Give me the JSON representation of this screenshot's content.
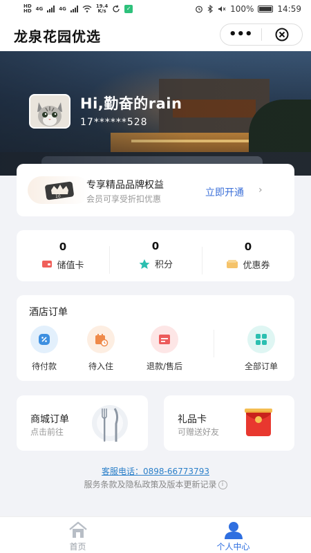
{
  "statusbar": {
    "net_left_1": "HD",
    "net_left_2": "HD",
    "network1": "4G",
    "network2": "4G",
    "speed_value": "19.4",
    "speed_unit": "K/s",
    "battery": "100%",
    "time": "14:59"
  },
  "header": {
    "title": "龙泉花园优选",
    "more_icon": "more-dots-icon",
    "close_icon": "close-circle-icon"
  },
  "profile": {
    "greeting": "Hi,勤奋的rain",
    "phone": "17******528"
  },
  "membership": {
    "title": "专享精品品牌权益",
    "subtitle": "会员可享受折扣优惠",
    "action": "立即开通",
    "chevron": "›",
    "badge_text": "10"
  },
  "stats": [
    {
      "value": "0",
      "label": "储值卡",
      "icon": "stored-value-card-icon",
      "color": "#f0605a"
    },
    {
      "value": "0",
      "label": "积分",
      "icon": "star-icon",
      "color": "#2bbfb0"
    },
    {
      "value": "0",
      "label": "优惠券",
      "icon": "coupon-icon",
      "color": "#f5c36a"
    }
  ],
  "hotel_orders": {
    "title": "酒店订单",
    "items": [
      {
        "label": "待付款",
        "icon": "pending-payment-icon",
        "color": "#3d8fe0",
        "bg": "#e3f0fc"
      },
      {
        "label": "待入住",
        "icon": "pending-checkin-icon",
        "color": "#ef8a4a",
        "bg": "#fdeee2"
      },
      {
        "label": "退款/售后",
        "icon": "refund-icon",
        "color": "#ec5b5b",
        "bg": "#fde6e6"
      },
      {
        "label": "全部订单",
        "icon": "all-orders-icon",
        "color": "#2bbfb0",
        "bg": "#dff6f3"
      }
    ]
  },
  "mall_order": {
    "title": "商城订单",
    "subtitle": "点击前往"
  },
  "gift_card": {
    "title": "礼品卡",
    "subtitle": "可赠送好友"
  },
  "footer": {
    "service_phone": "客服电话：0898-66773793",
    "terms": "服务条款及隐私政策及版本更新记录"
  },
  "tabs": [
    {
      "label": "首页",
      "icon": "home-icon",
      "active": false
    },
    {
      "label": "个人中心",
      "icon": "user-icon",
      "active": true
    }
  ],
  "colors": {
    "accent": "#3b6fd8",
    "active_tab": "#2f6fe0",
    "inactive_tab": "#9aa0a8",
    "link": "#2a7fc9"
  }
}
